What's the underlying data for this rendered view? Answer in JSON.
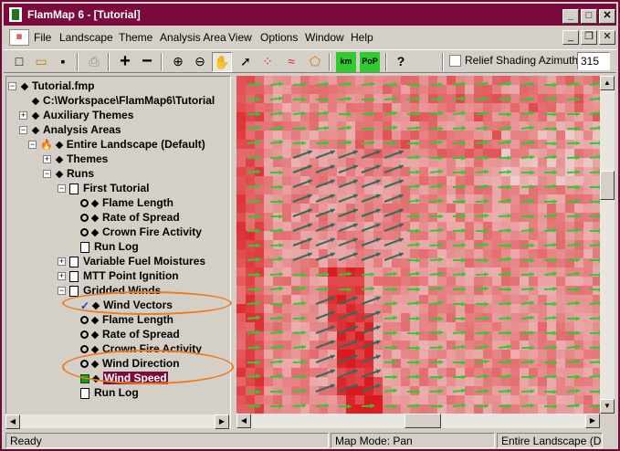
{
  "window": {
    "title": "FlamMap 6 - [Tutorial]"
  },
  "menu": [
    "File",
    "Landscape",
    "Theme",
    "Analysis Area",
    "View",
    "Options",
    "Window",
    "Help"
  ],
  "toolbar": {
    "relief_label": "Relief Shading Azimuth:",
    "azimuth_value": "315",
    "buttons": [
      {
        "name": "new-button",
        "icon": "new-file-icon",
        "glyph": "□"
      },
      {
        "name": "open-button",
        "icon": "folder-icon",
        "glyph": "▭"
      },
      {
        "name": "save-button",
        "icon": "save-icon",
        "glyph": "▪"
      },
      {
        "name": "print-button",
        "icon": "printer-icon",
        "glyph": "⎙"
      },
      {
        "name": "add-button",
        "icon": "plus-icon",
        "glyph": "+"
      },
      {
        "name": "remove-button",
        "icon": "minus-icon",
        "glyph": "−"
      },
      {
        "name": "zoom-in-button",
        "icon": "zoom-in-icon",
        "glyph": "⊕"
      },
      {
        "name": "zoom-out-button",
        "icon": "zoom-out-icon",
        "glyph": "⊖"
      },
      {
        "name": "pan-button",
        "icon": "hand-icon",
        "glyph": "✋"
      },
      {
        "name": "select-button",
        "icon": "pointer-icon",
        "glyph": "➚"
      },
      {
        "name": "point-ignition-button",
        "icon": "points-icon",
        "glyph": "⁘"
      },
      {
        "name": "line-ignition-button",
        "icon": "lines-icon",
        "glyph": "≈"
      },
      {
        "name": "polygon-button",
        "icon": "polygon-icon",
        "glyph": "⬠"
      },
      {
        "name": "km-button",
        "icon": "km-icon",
        "glyph": "km"
      },
      {
        "name": "pop-button",
        "icon": "pop-icon",
        "glyph": "PoP"
      },
      {
        "name": "help-button",
        "icon": "help-icon",
        "glyph": "?"
      }
    ]
  },
  "tree": [
    {
      "label": "Tutorial.fmp",
      "level": 0,
      "exp": "−",
      "icon": "diamond"
    },
    {
      "label": "C:\\Workspace\\FlamMap6\\Tutorial",
      "level": 1,
      "exp": "",
      "icon": "diamond"
    },
    {
      "label": "Auxiliary Themes",
      "level": 1,
      "exp": "+",
      "icon": "diamond"
    },
    {
      "label": "Analysis Areas",
      "level": 1,
      "exp": "−",
      "icon": "diamond"
    },
    {
      "label": "Entire Landscape (Default)",
      "level": 2,
      "exp": "−",
      "icon": "flame"
    },
    {
      "label": "Themes",
      "level": 3,
      "exp": "+",
      "icon": "diamond"
    },
    {
      "label": "Runs",
      "level": 3,
      "exp": "−",
      "icon": "diamond"
    },
    {
      "label": "First Tutorial",
      "level": 4,
      "exp": "−",
      "icon": "doc"
    },
    {
      "label": "Flame Length",
      "level": 5,
      "exp": "",
      "icon": "mag"
    },
    {
      "label": "Rate of Spread",
      "level": 5,
      "exp": "",
      "icon": "mag"
    },
    {
      "label": "Crown Fire Activity",
      "level": 5,
      "exp": "",
      "icon": "mag"
    },
    {
      "label": "Run Log",
      "level": 5,
      "exp": "",
      "icon": "doc"
    },
    {
      "label": "Variable Fuel Moistures",
      "level": 4,
      "exp": "+",
      "icon": "doc"
    },
    {
      "label": "MTT Point Ignition",
      "level": 4,
      "exp": "+",
      "icon": "doc"
    },
    {
      "label": "Gridded Winds",
      "level": 4,
      "exp": "−",
      "icon": "doc"
    },
    {
      "label": "Wind Vectors",
      "level": 5,
      "exp": "",
      "icon": "check"
    },
    {
      "label": "Flame Length",
      "level": 5,
      "exp": "",
      "icon": "mag"
    },
    {
      "label": "Rate of Spread",
      "level": 5,
      "exp": "",
      "icon": "mag"
    },
    {
      "label": "Crown Fire Activity",
      "level": 5,
      "exp": "",
      "icon": "mag"
    },
    {
      "label": "Wind Direction",
      "level": 5,
      "exp": "",
      "icon": "mag"
    },
    {
      "label": "Wind Speed",
      "level": 5,
      "exp": "",
      "icon": "square",
      "selected": true
    },
    {
      "label": "Run Log",
      "level": 5,
      "exp": "",
      "icon": "doc"
    }
  ],
  "status": {
    "ready": "Ready",
    "mode": "Map Mode: Pan",
    "area": "Entire Landscape (Defau"
  },
  "colors": {
    "title": "#7a0b3c",
    "vector": "#2ecc2e",
    "vector_dark": "#2d6e5a",
    "highlight": "#f07a1e"
  }
}
